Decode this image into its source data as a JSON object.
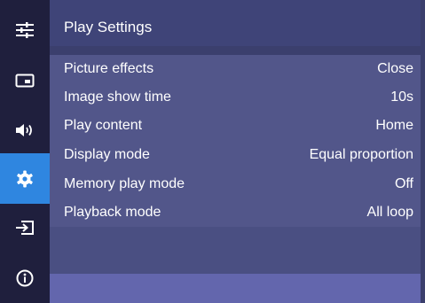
{
  "sidebar": {
    "items": [
      {
        "icon": "sliders-icon",
        "active": false
      },
      {
        "icon": "picture-icon",
        "active": false
      },
      {
        "icon": "speaker-icon",
        "active": false
      },
      {
        "icon": "gear-icon",
        "active": true
      },
      {
        "icon": "input-source-icon",
        "active": false
      },
      {
        "icon": "info-icon",
        "active": false
      }
    ],
    "active_color": "#2f86e0"
  },
  "header": {
    "title": "Play Settings"
  },
  "settings": [
    {
      "label": "Picture effects",
      "value": "Close"
    },
    {
      "label": "Image show time",
      "value": "10s"
    },
    {
      "label": "Play content",
      "value": "Home"
    },
    {
      "label": "Display mode",
      "value": "Equal proportion"
    },
    {
      "label": "Memory play mode",
      "value": "Off"
    },
    {
      "label": "Playback mode",
      "value": "All loop"
    }
  ]
}
